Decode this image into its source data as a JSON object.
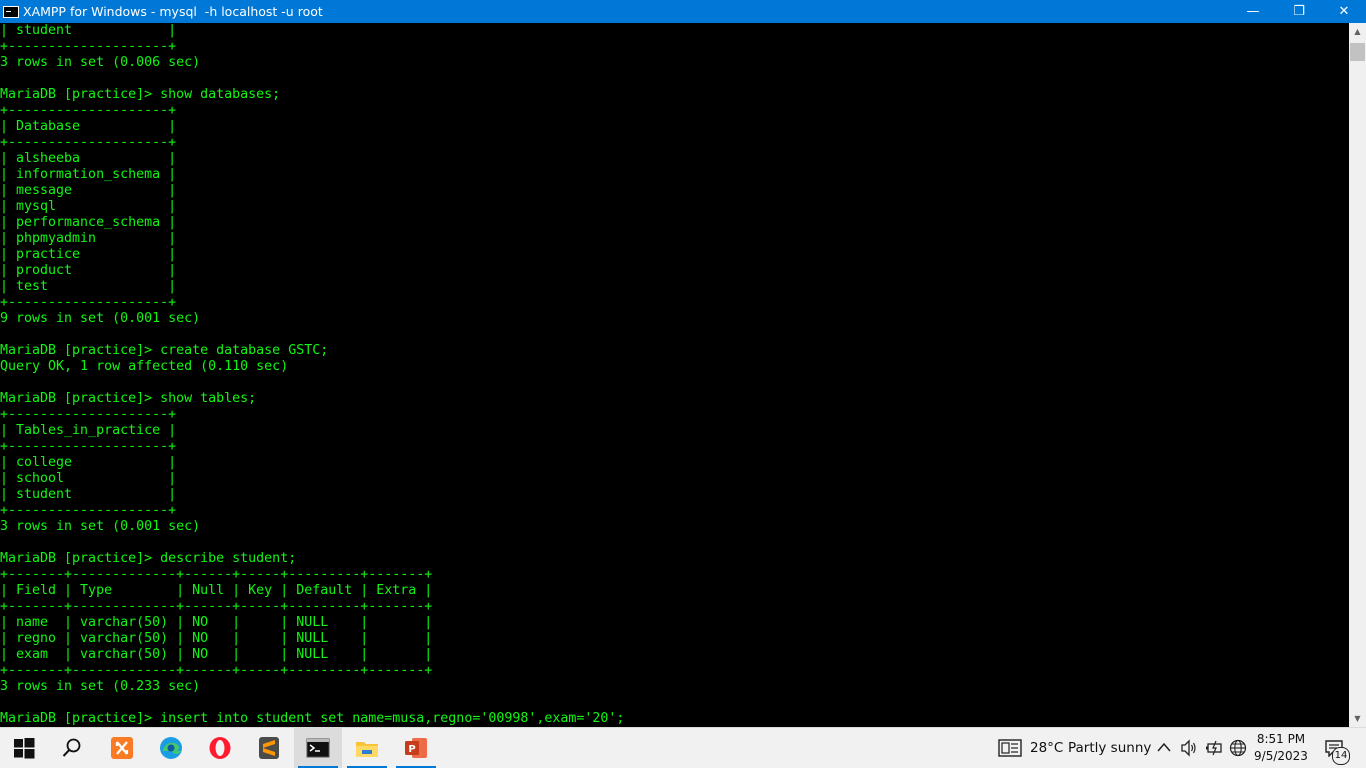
{
  "window": {
    "title": "XAMPP for Windows - mysql  -h localhost -u root",
    "minimize_glyph": "—",
    "restore_glyph": "❐",
    "close_glyph": "✕"
  },
  "console": {
    "lines": [
      "| student            |",
      "+--------------------+",
      "3 rows in set (0.006 sec)",
      "",
      "MariaDB [practice]> show databases;",
      "+--------------------+",
      "| Database           |",
      "+--------------------+",
      "| alsheeba           |",
      "| information_schema |",
      "| message            |",
      "| mysql              |",
      "| performance_schema |",
      "| phpmyadmin         |",
      "| practice           |",
      "| product            |",
      "| test               |",
      "+--------------------+",
      "9 rows in set (0.001 sec)",
      "",
      "MariaDB [practice]> create database GSTC;",
      "Query OK, 1 row affected (0.110 sec)",
      "",
      "MariaDB [practice]> show tables;",
      "+--------------------+",
      "| Tables_in_practice |",
      "+--------------------+",
      "| college            |",
      "| school             |",
      "| student            |",
      "+--------------------+",
      "3 rows in set (0.001 sec)",
      "",
      "MariaDB [practice]> describe student;",
      "+-------+-------------+------+-----+---------+-------+",
      "| Field | Type        | Null | Key | Default | Extra |",
      "+-------+-------------+------+-----+---------+-------+",
      "| name  | varchar(50) | NO   |     | NULL    |       |",
      "| regno | varchar(50) | NO   |     | NULL    |       |",
      "| exam  | varchar(50) | NO   |     | NULL    |       |",
      "+-------+-------------+------+-----+---------+-------+",
      "3 rows in set (0.233 sec)",
      "",
      "MariaDB [practice]> insert into student set name=musa,regno='00998',exam='20';"
    ]
  },
  "taskbar": {
    "apps": [
      {
        "icon": "windows-start-icon"
      },
      {
        "icon": "search-icon"
      },
      {
        "icon": "xampp-icon"
      },
      {
        "icon": "edge-icon"
      },
      {
        "icon": "opera-icon"
      },
      {
        "icon": "sublime-text-icon"
      },
      {
        "icon": "command-prompt-icon"
      },
      {
        "icon": "file-explorer-icon"
      },
      {
        "icon": "powerpoint-icon"
      }
    ],
    "weather": {
      "temperature": "28°C",
      "condition": "Partly sunny"
    },
    "clock": {
      "time": "8:51 PM",
      "date": "9/5/2023"
    },
    "notifications": {
      "count": "14"
    }
  },
  "colors": {
    "titlebar": "#0078d7",
    "console_text": "#13f413",
    "console_bg": "#000000",
    "taskbar_bg": "#f1f1f1"
  }
}
